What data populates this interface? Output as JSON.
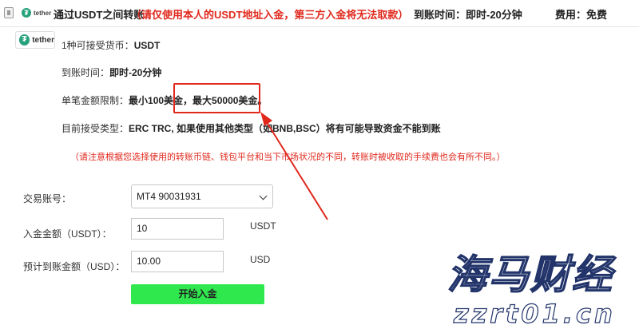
{
  "header": {
    "logo_word": "tether",
    "title": "通过USDT之间转账",
    "warning": "（请仅使用本人的USDT地址入金，第三方入金将无法取款）",
    "arrival": "到账时间：即时-20分钟",
    "fee": "费用：免费"
  },
  "brand": {
    "logo_word": "tether",
    "logo_glyph": "₮"
  },
  "info": {
    "currency_label": "1种可接受货币：",
    "currency_value": "USDT",
    "time_label": "到账时间：",
    "time_value": "即时-20分钟",
    "limit_label": "单笔金额限制：",
    "limit_min": "最小100美金，",
    "limit_max": "最大50000美金。",
    "type_label": "目前接受类型：",
    "type_value": "ERC TRC, 如果使用其他类型（如BNB,BSC）将有可能导致资金不能到账",
    "note": "（请注意根据您选择使用的转账币链、钱包平台和当下市场状况的不同，转账时被收取的手续费也会有所不同。）"
  },
  "form": {
    "account_label": "交易账号：",
    "account_value": "MT4 90031931",
    "deposit_label": "入金金额（USDT）：",
    "deposit_value": "10",
    "deposit_unit": "USDT",
    "estimate_label": "预计到账金额（USD）：",
    "estimate_value": "10.00",
    "estimate_unit": "USD",
    "submit_label": "开始入金"
  },
  "watermark": {
    "brand": "海马财经",
    "site": "zzrt01.cn"
  },
  "colors": {
    "warning_red": "#e0281c",
    "tether_green": "#26a17b",
    "button_green": "#2ee84e",
    "watermark_navy": "#22346a"
  }
}
